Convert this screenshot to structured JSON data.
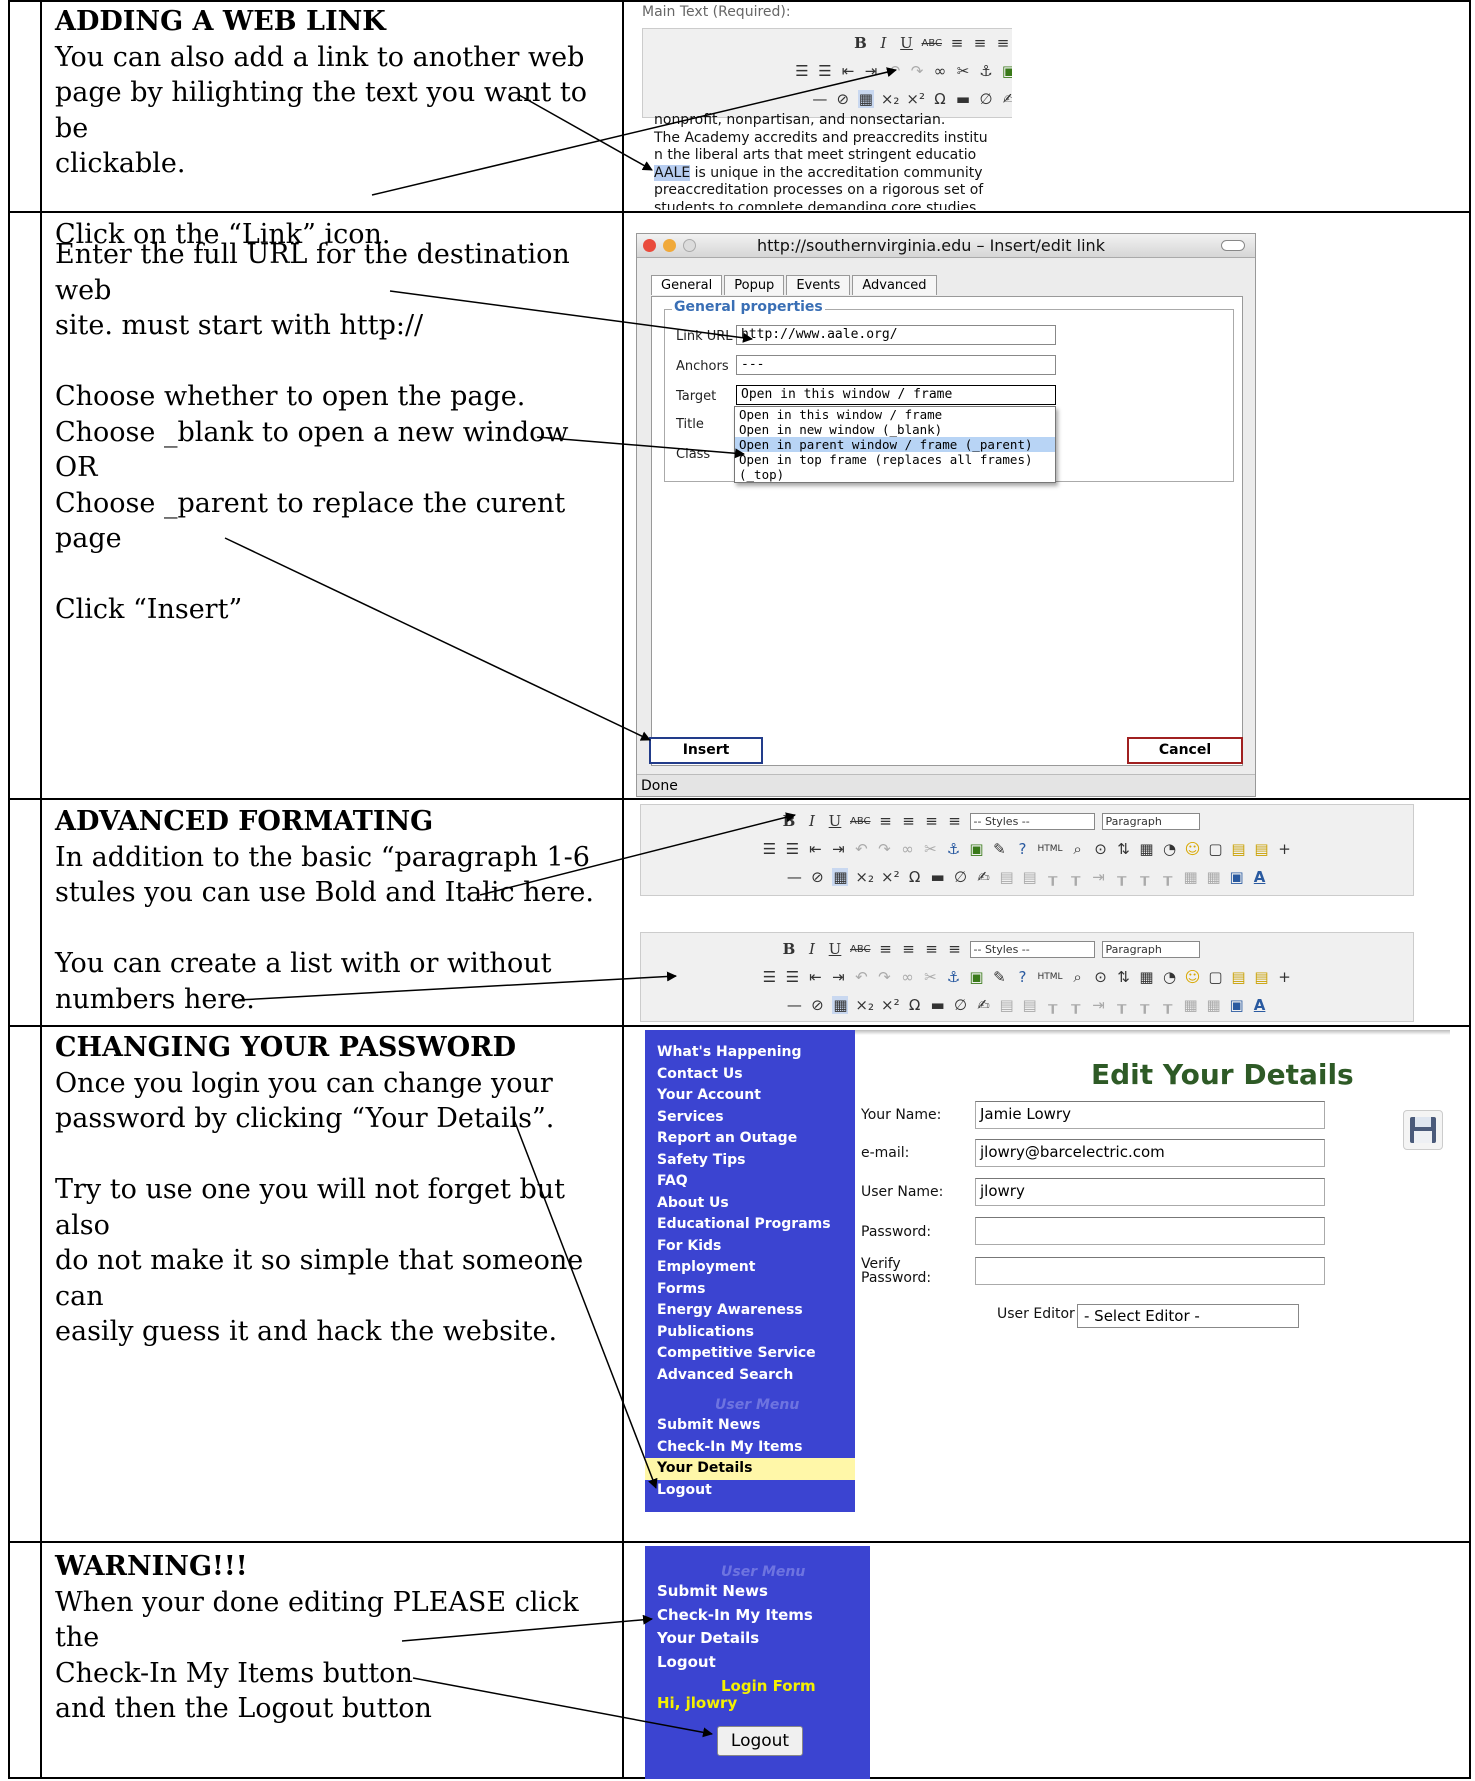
{
  "sections": [
    {
      "heading": "ADDING A WEB LINK",
      "lines": [
        "You can also add a link to another web",
        "page by hilighting the text you want to be",
        "clickable.",
        "",
        "Click on the “Link” icon."
      ]
    },
    {
      "heading": "",
      "lines": [
        "Enter the full URL for the destination web",
        "site. must start with http://",
        "",
        "Choose whether to open the page.",
        "Choose _blank to open a new window",
        "OR",
        "Choose _parent to replace the curent page",
        "",
        "Click “Insert”"
      ]
    },
    {
      "heading": "ADVANCED FORMATING",
      "lines": [
        "In addition to the basic “paragraph 1-6",
        "stules you can use Bold and Italic here.",
        "",
        "You can create a list with or without",
        "numbers here."
      ]
    },
    {
      "heading": "CHANGING YOUR PASSWORD",
      "lines": [
        "Once you login you can change your",
        "password by clicking “Your Details”.",
        "",
        "Try to use one you will not forget but also",
        "do not make it so simple that someone can",
        "easily guess it and hack the website."
      ]
    },
    {
      "heading": "WARNING!!!",
      "lines": [
        "When your done editing PLEASE click the",
        "Check-In My Items button",
        "and then the Logout button"
      ]
    }
  ],
  "editor": {
    "main_text_label": "Main Text (Required):",
    "body_lines": [
      "nonprofit, nonpartisan, and nonsectarian.",
      "The Academy accredits and preaccredits institu",
      "n the liberal arts that meet stringent educatio",
      "is unique in the accreditation community",
      "preaccreditation processes on a rigorous set of",
      "students to complete demanding core studies"
    ],
    "highlight_word": "AALE"
  },
  "toolbar": {
    "styles_select": "-- Styles --",
    "paragraph_select": "Paragraph",
    "row1_icons": [
      "B",
      "I",
      "U",
      "ABC",
      "≡",
      "≡",
      "≡",
      "≡"
    ],
    "row2_icons": [
      "☰",
      "☰",
      "⇤",
      "⇥",
      "↶",
      "↷",
      "∞",
      "✂",
      "⚓",
      "▣",
      "✎",
      "?",
      "HTML",
      "⌕",
      "⊙",
      "⇅",
      "▦",
      "◔",
      "☺",
      "▢",
      "▤",
      "▤",
      "+"
    ],
    "row3_icons": [
      "—",
      "⊘",
      "▦",
      "×₂",
      "×²",
      "Ω",
      "▬",
      "∅",
      "✍",
      "▤",
      "▤",
      "┰",
      "┰",
      "⇥",
      "┰",
      "┰",
      "┰",
      "▦",
      "▦",
      "▣",
      "A"
    ]
  },
  "dialog": {
    "title": "http://southernvirginia.edu – Insert/edit link",
    "tabs": [
      "General",
      "Popup",
      "Events",
      "Advanced"
    ],
    "group_label": "General properties",
    "link_url_label": "Link URL",
    "link_url_value": "http://www.aale.org/",
    "anchors_label": "Anchors",
    "anchors_value": "---",
    "target_label": "Target",
    "target_value": "Open in this window / frame",
    "title_label": "Title",
    "class_label": "Class",
    "target_options": [
      "Open in this window / frame",
      "Open in new window (_blank)",
      "Open in parent window / frame (_parent)",
      "Open in top frame (replaces all frames) (_top)"
    ],
    "insert_label": "Insert",
    "cancel_label": "Cancel",
    "status": "Done"
  },
  "site_menu": {
    "items": [
      "What's Happening",
      "Contact Us",
      "Your Account",
      "Services",
      "Report an Outage",
      "Safety Tips",
      "FAQ",
      "About Us",
      "Educational Programs",
      "For Kids",
      "Employment",
      "Forms",
      "Energy Awareness",
      "Publications",
      "Competitive Service",
      "Advanced Search"
    ],
    "user_menu_title": "User Menu",
    "user_items": [
      "Submit News",
      "Check-In My Items",
      "Your Details",
      "Logout"
    ]
  },
  "details_form": {
    "title": "Edit Your Details",
    "name_label": "Your Name:",
    "name_value": "Jamie Lowry",
    "email_label": "e-mail:",
    "email_value": "jlowry@barcelectric.com",
    "username_label": "User Name:",
    "username_value": "jlowry",
    "password_label": "Password:",
    "verify_label_1": "Verify",
    "verify_label_2": "Password:",
    "editor_label": "User Editor",
    "editor_value": "- Select Editor -"
  },
  "login_panel": {
    "user_menu_title": "User Menu",
    "items": [
      "Submit News",
      "Check-In My Items",
      "Your Details",
      "Logout"
    ],
    "login_form_title": "Login Form",
    "greeting": "Hi, jlowry",
    "logout_button": "Logout"
  },
  "colors": {
    "menu_blue": "#3b44d1",
    "menu_highlight": "#fff7a8",
    "form_title_green": "#2e5a26",
    "option_highlight": "#b8d4f5",
    "text_highlight": "#b7cdf0"
  }
}
